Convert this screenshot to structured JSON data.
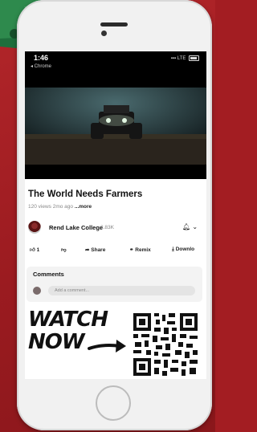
{
  "status_bar": {
    "time": "1:46",
    "back_app": "◂ Chrome",
    "signal": "LTE"
  },
  "video": {
    "title": "The World Needs Farmers",
    "views": "120 views",
    "age": "2mo ago",
    "more": "...more"
  },
  "channel": {
    "name": "Rend Lake College",
    "subscribers": "2.83K",
    "bell": "🔔︎ ⌄"
  },
  "actions": {
    "like_count": "1",
    "share": "Share",
    "remix": "Remix",
    "download": "Downlo"
  },
  "comments": {
    "heading": "Comments",
    "placeholder": "Add a comment..."
  },
  "promo": {
    "line1": "WATCH",
    "line2": "NOW"
  },
  "colors": {
    "background": "#a31d22",
    "phone_body": "#f1f1f1",
    "screen": "#ffffff"
  }
}
